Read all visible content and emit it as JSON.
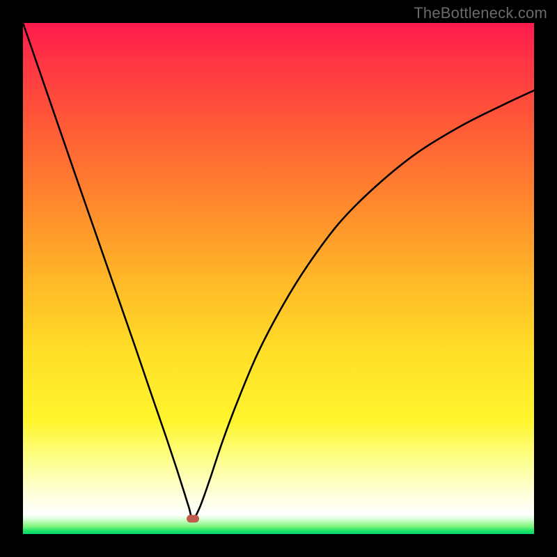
{
  "watermark": "TheBottleneck.com",
  "colors": {
    "frame": "#000000",
    "curve": "#000000",
    "minpoint": "#c05a4d"
  },
  "chart_data": {
    "type": "line",
    "title": "",
    "xlabel": "",
    "ylabel": "",
    "xlim": [
      0,
      100
    ],
    "ylim": [
      0,
      100
    ],
    "grid": false,
    "legend": false,
    "annotations": [
      "TheBottleneck.com"
    ],
    "series": [
      {
        "name": "bottleneck-curve",
        "x": [
          0,
          5,
          10,
          14,
          18,
          22,
          25,
          28,
          30,
          31.5,
          32.5,
          33.2,
          34.5,
          36.5,
          39,
          42,
          46,
          51,
          56,
          62,
          69,
          77,
          86,
          94,
          100
        ],
        "values": [
          100,
          85.5,
          71,
          59.5,
          48,
          36.5,
          27.7,
          19,
          13,
          8.3,
          5.1,
          3,
          5,
          10.5,
          18,
          26,
          35.5,
          45,
          53,
          61,
          68,
          74.5,
          80,
          84,
          86.8
        ]
      }
    ],
    "min_marker": {
      "x": 33.2,
      "y": 3
    }
  }
}
